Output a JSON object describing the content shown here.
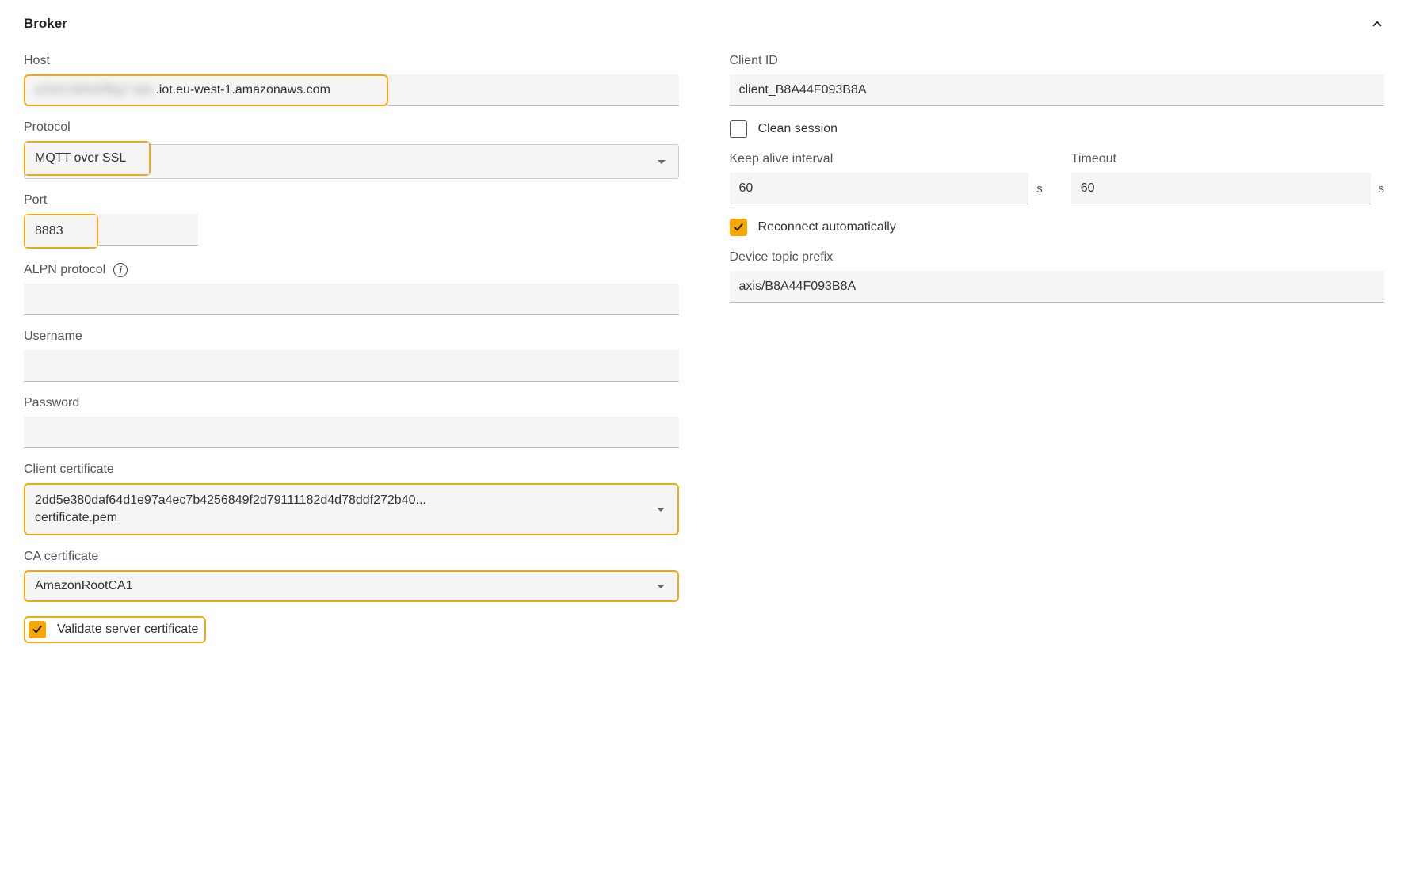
{
  "section": {
    "title": "Broker"
  },
  "left": {
    "host_label": "Host",
    "host_blurred": "a1b2c3d4e5f6g7-abc",
    "host_visible": ".iot.eu-west-1.amazonaws.com",
    "protocol_label": "Protocol",
    "protocol_value": "MQTT over SSL",
    "port_label": "Port",
    "port_value": "8883",
    "alpn_label": "ALPN protocol",
    "alpn_value": "",
    "username_label": "Username",
    "username_value": "",
    "password_label": "Password",
    "password_value": "",
    "client_cert_label": "Client certificate",
    "client_cert_line1": "2dd5e380daf64d1e97a4ec7b4256849f2d79111182d4d78ddf272b40...",
    "client_cert_line2": "certificate.pem",
    "ca_cert_label": "CA certificate",
    "ca_cert_value": "AmazonRootCA1",
    "validate_label": "Validate server certificate"
  },
  "right": {
    "client_id_label": "Client ID",
    "client_id_value": "client_B8A44F093B8A",
    "clean_session_label": "Clean session",
    "keep_alive_label": "Keep alive interval",
    "keep_alive_value": "60",
    "timeout_label": "Timeout",
    "timeout_value": "60",
    "unit_s": "s",
    "reconnect_label": "Reconnect automatically",
    "prefix_label": "Device topic prefix",
    "prefix_value": "axis/B8A44F093B8A"
  }
}
